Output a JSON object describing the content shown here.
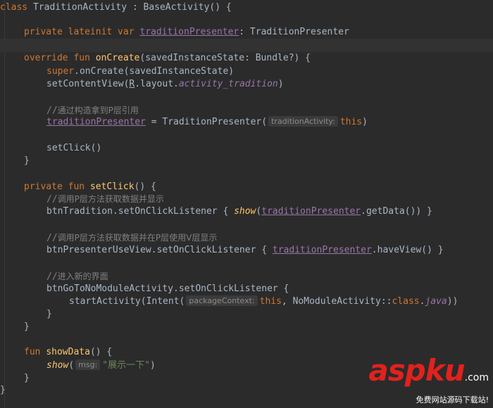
{
  "code": {
    "l1": {
      "kw": "class",
      "name": " TraditionActivity : BaseActivity() {"
    },
    "l2": {
      "kw": "private lateinit var ",
      "prop": "traditionPresenter",
      "rest": ": TraditionPresenter"
    },
    "l3": {
      "kw": "override fun ",
      "fn": "onCreate",
      "rest": "(savedInstanceState: Bundle?) {"
    },
    "l4": {
      "kw": "super",
      "rest": ".onCreate(savedInstanceState)"
    },
    "l5": {
      "pre": "setContentView(",
      "r": "R",
      "mid": ".layout.",
      "it": "activity_tradition",
      "post": ")"
    },
    "l6": {
      "slash": "//",
      "text": "通过构造拿到P层引用"
    },
    "l7": {
      "prop": "traditionPresenter",
      "mid": " = TraditionPresenter(",
      "hint": "traditionActivity:",
      "kw": "this",
      "post": ")"
    },
    "l8": {
      "text": "setClick()"
    },
    "l9": {
      "text": "}"
    },
    "l10": {
      "kw": "private fun ",
      "fn": "setClick",
      "rest": "() {"
    },
    "l11": {
      "slash": "//",
      "text": "调用P层方法获取数据并显示"
    },
    "l12": {
      "pre": "btnTradition.setOnClickListener { ",
      "fn": "show",
      "open": "(",
      "prop": "traditionPresenter",
      "post": ".getData()) }"
    },
    "l13": {
      "slash": "//",
      "text": "调用P层方法获取数据并在P层使用V层显示"
    },
    "l14": {
      "pre": "btnPresenterUseView.setOnClickListener { ",
      "prop": "traditionPresenter",
      "post": ".haveView() }"
    },
    "l15": {
      "slash": "//",
      "text": "进入新的界面"
    },
    "l16": {
      "text": "btnGoToNoModuleActivity.setOnClickListener {"
    },
    "l17": {
      "pre": "startActivity(Intent(",
      "hint": "packageContext:",
      "kw": "this",
      "mid": ", NoModuleActivity::",
      "kw2": "class",
      "dot": ".",
      "it": "java",
      "post": "))"
    },
    "l18": {
      "text": "}"
    },
    "l19": {
      "text": "}"
    },
    "l20": {
      "kw": "fun ",
      "fn": "showData",
      "rest": "() {"
    },
    "l21": {
      "fn": "show",
      "open": "(",
      "hint": "msg:",
      "str": "\"展示一下\"",
      "post": ")"
    },
    "l22": {
      "text": "}"
    },
    "l23": {
      "text": "}"
    }
  },
  "watermark": {
    "asp": "asp",
    "ku": "ku",
    "com": ".com",
    "tagline": "免费网站源码下载站!"
  },
  "colors": {
    "background": "#2b2b2b",
    "keyword": "#cc7832",
    "function": "#ffc66d",
    "property": "#9876aa",
    "string": "#6a8759",
    "comment": "#808080",
    "default": "#a9b7c6",
    "watermark_red": "#e0221e"
  }
}
